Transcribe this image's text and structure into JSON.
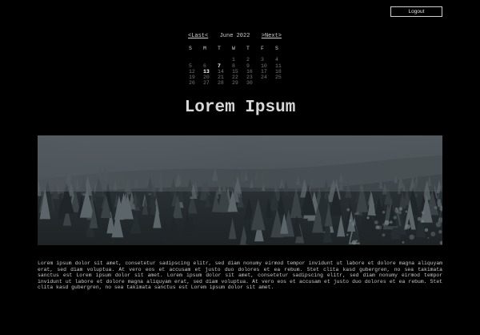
{
  "header": {
    "logout_label": "Logout"
  },
  "calendar": {
    "prev_label": "<Last<",
    "month_label": "June 2022",
    "next_label": ">Next>",
    "weekdays": [
      "S",
      "M",
      "T",
      "W",
      "T",
      "F",
      "S"
    ],
    "weeks": [
      [
        "",
        "",
        "",
        "1",
        "2",
        "3",
        "4"
      ],
      [
        "5",
        "6",
        "7",
        "8",
        "9",
        "10",
        "11"
      ],
      [
        "12",
        "13",
        "14",
        "15",
        "16",
        "17",
        "18"
      ],
      [
        "19",
        "20",
        "21",
        "22",
        "23",
        "24",
        "25"
      ],
      [
        "26",
        "27",
        "28",
        "29",
        "30",
        "",
        ""
      ]
    ],
    "highlighted_days": [
      "7",
      "13"
    ]
  },
  "main": {
    "title": "Lorem Ipsum",
    "image_alt": "Misty snow-covered pine forest",
    "paragraph": "Lorem ipsum dolor sit amet, consetetur sadipscing elitr, sed diam nonumy eirmod tempor invidunt ut labore et dolore magna aliquyam erat, sed diam voluptua. At vero eos et accusam et justo duo dolores et ea rebum. Stet clita kasd gubergren, no sea takimata sanctus est Lorem ipsum dolor sit amet. Lorem ipsum dolor sit amet, consetetur sadipscing elitr, sed diam nonumy eirmod tempor invidunt ut labore et dolore magna aliquyam erat, sed diam voluptua. At vero eos et accusam et justo duo dolores et ea rebum. Stet clita kasd gubergren, no sea takimata sanctus est Lorem ipsum dolor sit amet."
  },
  "colors": {
    "background": "#000000",
    "text": "#c8c8c8",
    "muted_day": "#777777"
  }
}
